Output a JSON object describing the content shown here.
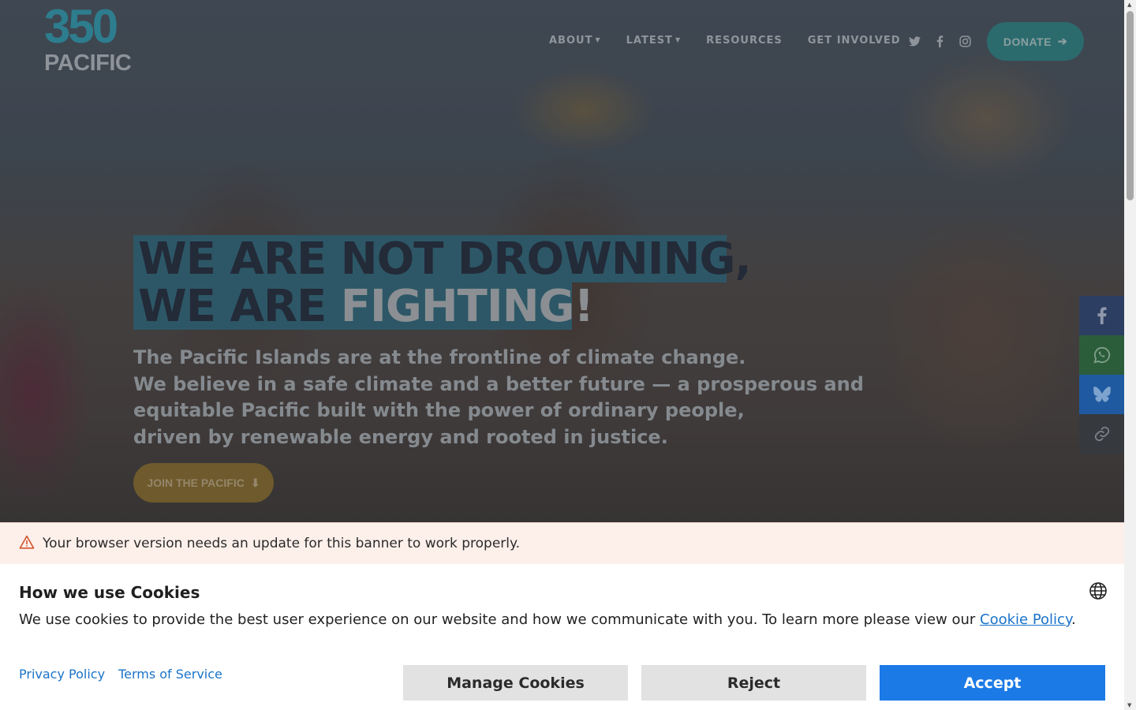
{
  "header": {
    "logo_number": "350",
    "logo_word": "PACIFIC",
    "nav": [
      {
        "label": "ABOUT",
        "has_dropdown": true
      },
      {
        "label": "LATEST",
        "has_dropdown": true
      },
      {
        "label": "RESOURCES",
        "has_dropdown": false
      },
      {
        "label": "GET INVOLVED",
        "has_dropdown": false
      }
    ],
    "social_icons": [
      "twitter-icon",
      "facebook-icon",
      "instagram-icon"
    ],
    "donate_label": "DONATE"
  },
  "hero": {
    "headline_line1": "WE ARE NOT DROWNING,",
    "headline_line2_prefix": "WE ARE ",
    "headline_line2_accent": "FIGHTING!",
    "lede": [
      "The Pacific Islands are at the frontline of climate change.",
      "We believe in a safe climate and a better future — a prosperous and",
      "equitable Pacific built with the power of ordinary people,",
      "driven by renewable energy and rooted in justice."
    ],
    "cta_label": "JOIN THE PACIFIC"
  },
  "share_bar": [
    "facebook-icon",
    "whatsapp-icon",
    "bluesky-icon",
    "link-icon"
  ],
  "warning_banner": {
    "text": "Your browser version needs an update for this banner to work properly."
  },
  "cookie_banner": {
    "title": "How we use Cookies",
    "body_prefix": "We use cookies to provide the best user experience on our website and how we communicate with you. To learn more please view our ",
    "body_link": "Cookie Policy",
    "body_suffix": ".",
    "privacy_label": "Privacy Policy",
    "terms_label": "Terms of Service",
    "manage_label": "Manage Cookies",
    "reject_label": "Reject",
    "accept_label": "Accept"
  },
  "colors": {
    "accept": "#1b7ae6",
    "link": "#1a73c9",
    "warning_icon": "#d2542c",
    "headline_highlight": "#2d5766"
  }
}
